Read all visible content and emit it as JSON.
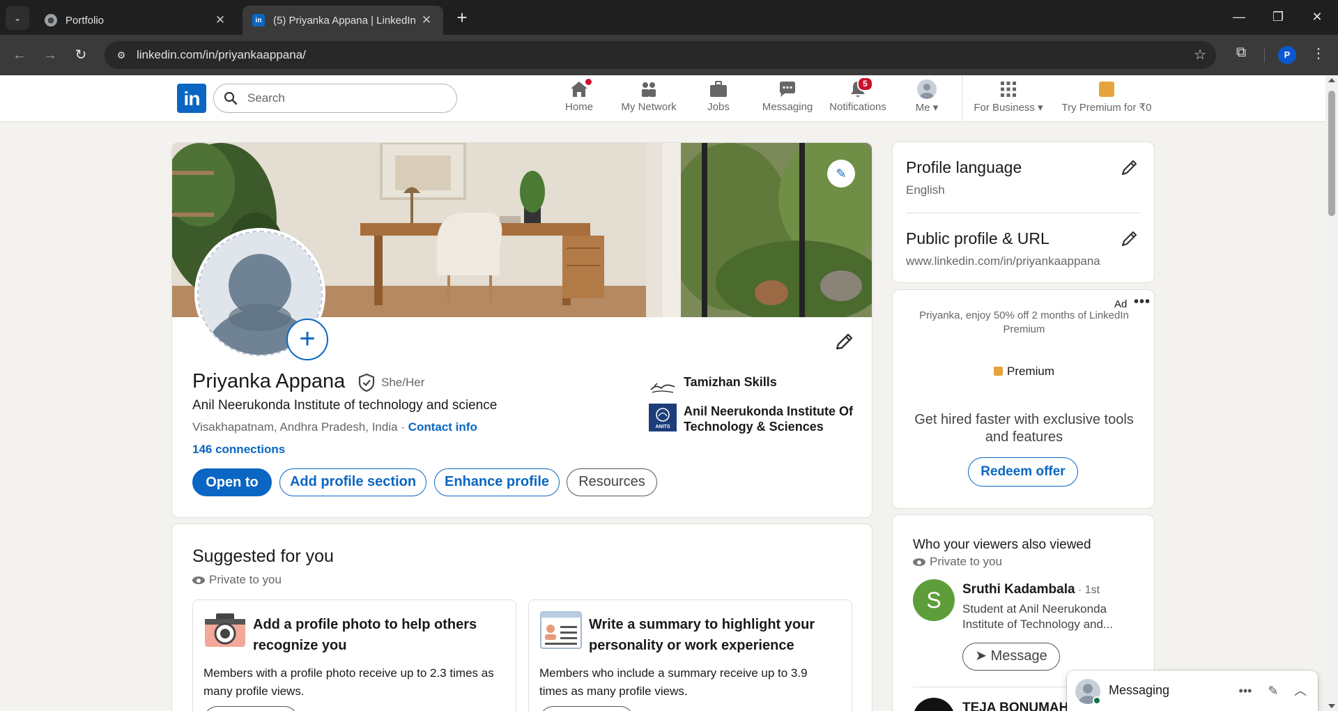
{
  "browser": {
    "tabs": [
      {
        "title": "Portfolio",
        "favicon": "globe-icon"
      },
      {
        "title": "(5) Priyanka Appana | LinkedIn",
        "favicon": "linkedin-icon",
        "active": true
      }
    ],
    "url": "linkedin.com/in/priyankaappana/",
    "profile_initial": "P"
  },
  "header": {
    "logo_text": "in",
    "search_placeholder": "Search",
    "nav": [
      {
        "label": "Home",
        "icon": "home-icon",
        "badge": ""
      },
      {
        "label": "My Network",
        "icon": "network-icon",
        "badge": ""
      },
      {
        "label": "Jobs",
        "icon": "briefcase-icon",
        "badge": ""
      },
      {
        "label": "Messaging",
        "icon": "chat-icon",
        "badge": ""
      },
      {
        "label": "Notifications",
        "icon": "bell-icon",
        "badge": "5"
      },
      {
        "label": "Me ▾",
        "icon": "avatar",
        "badge": ""
      },
      {
        "label": "For Business ▾",
        "icon": "grid-icon",
        "badge": ""
      },
      {
        "label": "Try Premium for ₹0",
        "icon": "premium-icon",
        "badge": ""
      }
    ]
  },
  "profile": {
    "name": "Priyanka Appana",
    "pronouns": "She/Her",
    "headline": "Anil Neerukonda Institute of technology and science",
    "location": "Visakhapatnam, Andhra Pradesh, India",
    "location_sep": " · ",
    "contact_info": "Contact info",
    "connections": "146 connections",
    "buttons": {
      "open_to": "Open to",
      "add_section": "Add profile section",
      "enhance": "Enhance profile",
      "resources": "Resources"
    },
    "orgs": [
      {
        "name": "Tamizhan Skills"
      },
      {
        "name": "Anil Neerukonda Institute Of Technology & Sciences",
        "logo_text": "ANITS"
      }
    ]
  },
  "suggested": {
    "title": "Suggested for you",
    "private": "Private to you",
    "cards": [
      {
        "title": "Add a profile photo to help others recognize you",
        "desc": "Members with a profile photo receive up to 2.3 times as many profile views."
      },
      {
        "title": "Write a summary to highlight your personality or work experience",
        "desc": "Members who include a summary receive up to 3.9 times as many profile views."
      }
    ]
  },
  "rail": {
    "language": {
      "title": "Profile language",
      "value": "English"
    },
    "public_profile": {
      "title": "Public profile & URL",
      "value": "www.linkedin.com/in/priyankaappana"
    },
    "ad": {
      "label": "Ad",
      "more": "•••",
      "text": "Priyanka, enjoy 50% off 2 months of LinkedIn Premium",
      "premium": "Premium",
      "pitch": "Get hired faster with exclusive tools and features",
      "cta": "Redeem offer"
    },
    "viewers": {
      "title": "Who your viewers also viewed",
      "private": "Private to you",
      "people": [
        {
          "initial": "S",
          "name": "Sruthi Kadambala",
          "degree": " · 1st",
          "headline": "Student at Anil Neerukonda Institute of Technology and...",
          "cta": "Message"
        },
        {
          "name": "TEJA BONUMAH"
        }
      ]
    }
  },
  "messaging": {
    "title": "Messaging"
  },
  "colors": {
    "brand": "#0a66c2",
    "badge": "#cb112d",
    "premium": "#e7a33e"
  }
}
